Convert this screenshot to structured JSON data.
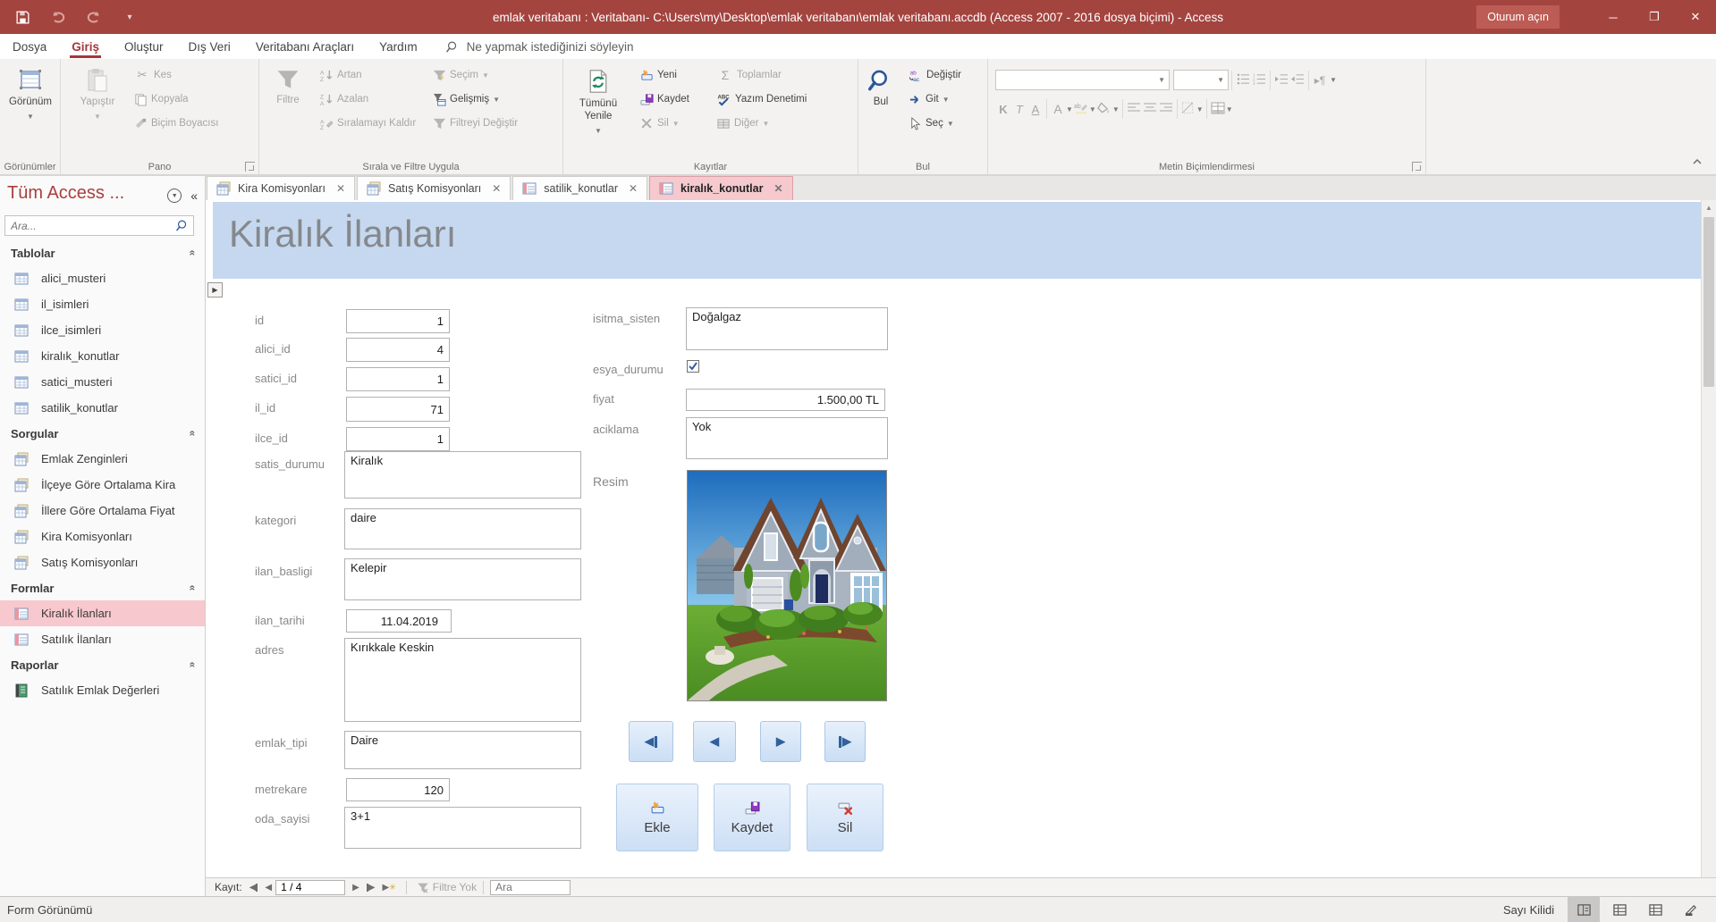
{
  "title_bar": {
    "title": "emlak veritabanı : Veritabanı- C:\\Users\\my\\Desktop\\emlak veritabanı\\emlak veritabanı.accdb (Access 2007 - 2016 dosya biçimi)  -  Access",
    "sign_in_label": "Oturum açın"
  },
  "menu": {
    "tabs": [
      "Dosya",
      "Giriş",
      "Oluştur",
      "Dış Veri",
      "Veritabanı Araçları",
      "Yardım"
    ],
    "tell_me": "Ne yapmak istediğinizi söyleyin"
  },
  "ribbon": {
    "views": {
      "label": "Görünümler",
      "view_btn": "Görünüm"
    },
    "clipboard": {
      "label": "Pano",
      "paste": "Yapıştır",
      "cut": "Kes",
      "copy": "Kopyala",
      "format_painter": "Biçim Boyacısı"
    },
    "sort_filter": {
      "label": "Sırala ve Filtre Uygula",
      "filter": "Filtre",
      "asc": "Artan",
      "desc": "Azalan",
      "remove_sort": "Sıralamayı Kaldır",
      "selection": "Seçim",
      "advanced": "Gelişmiş",
      "toggle_filter": "Filtreyi Değiştir"
    },
    "records": {
      "label": "Kayıtlar",
      "refresh_all": "Tümünü Yenile",
      "new": "Yeni",
      "save": "Kaydet",
      "delete": "Sil",
      "totals": "Toplamlar",
      "spelling": "Yazım Denetimi",
      "more": "Diğer"
    },
    "find": {
      "label": "Bul",
      "find": "Bul",
      "replace": "Değiştir",
      "goto": "Git",
      "select": "Seç"
    },
    "text_format": {
      "label": "Metin Biçimlendirmesi",
      "bold": "K",
      "italic": "T",
      "underline": "A"
    }
  },
  "nav_pane": {
    "title": "Tüm Access ...",
    "search_placeholder": "Ara...",
    "tables_header": "Tablolar",
    "queries_header": "Sorgular",
    "forms_header": "Formlar",
    "reports_header": "Raporlar",
    "tables": [
      "alici_musteri",
      "il_isimleri",
      "ilce_isimleri",
      "kiralık_konutlar",
      "satici_musteri",
      "satilik_konutlar"
    ],
    "queries": [
      "Emlak Zenginleri",
      "İlçeye Göre Ortalama Kira",
      "İllere Göre Ortalama Fiyat",
      "Kira Komisyonları",
      "Satış Komisyonları"
    ],
    "forms": [
      "Kiralık İlanları",
      "Satılık İlanları"
    ],
    "reports": [
      "Satılık Emlak Değerleri"
    ],
    "selected_item": "Kiralık İlanları"
  },
  "doc_tabs": [
    {
      "label": "Kira Komisyonları"
    },
    {
      "label": "Satış Komisyonları"
    },
    {
      "label": "satilik_konutlar"
    },
    {
      "label": "kiralık_konutlar"
    }
  ],
  "form": {
    "title": "Kiralık İlanları",
    "fields": {
      "id": {
        "label": "id",
        "value": "1"
      },
      "alici_id": {
        "label": "alici_id",
        "value": "4"
      },
      "satici_id": {
        "label": "satici_id",
        "value": "1"
      },
      "il_id": {
        "label": "il_id",
        "value": "71"
      },
      "ilce_id": {
        "label": "ilce_id",
        "value": "1"
      },
      "satis_durumu": {
        "label": "satis_durumu",
        "value": "Kiralık"
      },
      "kategori": {
        "label": "kategori",
        "value": "daire"
      },
      "ilan_basligi": {
        "label": "ilan_basligi",
        "value": "Kelepir"
      },
      "ilan_tarihi": {
        "label": "ilan_tarihi",
        "value": "11.04.2019"
      },
      "adres": {
        "label": "adres",
        "value": "Kırıkkale Keskin"
      },
      "emlak_tipi": {
        "label": "emlak_tipi",
        "value": "Daire"
      },
      "metrekare": {
        "label": "metrekare",
        "value": "120"
      },
      "oda_sayisi": {
        "label": "oda_sayisi",
        "value": "3+1"
      },
      "isitma_sistemi": {
        "label": "isitma_sisten",
        "value": "Doğalgaz"
      },
      "esya_durumu": {
        "label": "esya_durumu",
        "checked": "checked"
      },
      "fiyat": {
        "label": "fiyat",
        "value": "1.500,00 TL"
      },
      "aciklama": {
        "label": "aciklama",
        "value": "Yok"
      },
      "resim": {
        "label": "Resim"
      }
    },
    "buttons": {
      "add": "Ekle",
      "save": "Kaydet",
      "delete": "Sil"
    }
  },
  "record_nav": {
    "label": "Kayıt:",
    "position": "1 / 4",
    "filter_status": "Filtre Yok",
    "search_placeholder": "Ara"
  },
  "status_bar": {
    "left": "Form Görünümü",
    "num_lock": "Sayı Kilidi"
  },
  "colors": {
    "titlebar": "#a4443f",
    "accent_red": "#a4373a",
    "selection_pink": "#f7c8cd",
    "form_header_blue": "#c5d8ef",
    "button_blue": "#cddff5"
  }
}
